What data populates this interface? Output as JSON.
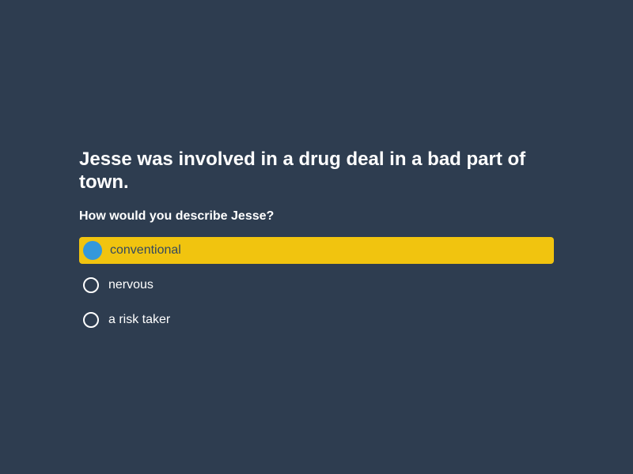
{
  "survey": {
    "title": "Jesse was involved in a drug deal in a bad part of town.",
    "question": "How would you describe Jesse?",
    "options": [
      {
        "label": "conventional",
        "selected": true
      },
      {
        "label": "nervous",
        "selected": false
      },
      {
        "label": "a risk taker",
        "selected": false
      }
    ]
  },
  "colors": {
    "background": "#2e3d50",
    "selected_option_bg": "#f1c40f",
    "selected_radio": "#3498db",
    "text": "#ffffff"
  }
}
